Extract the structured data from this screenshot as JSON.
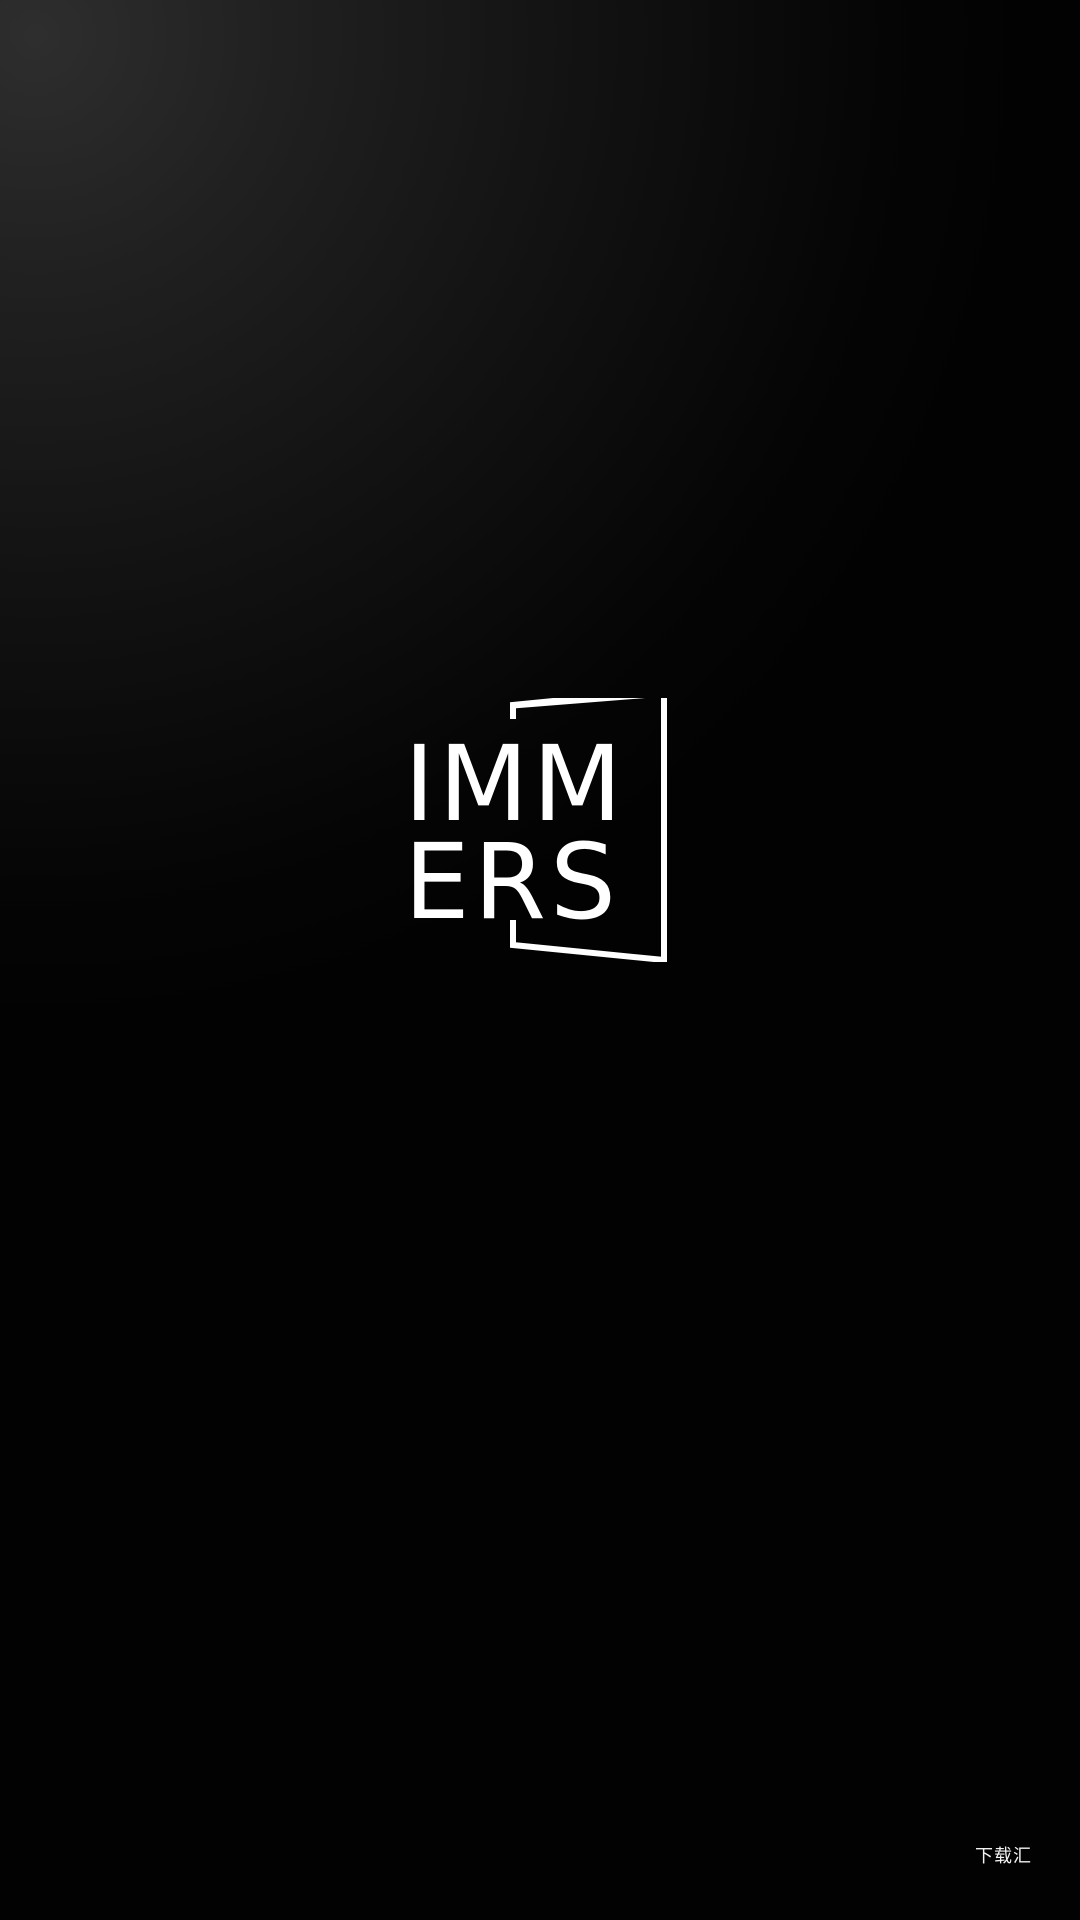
{
  "splash": {
    "logo": {
      "line1": "IMM",
      "line2": "ERS"
    },
    "watermark": "下载汇"
  }
}
